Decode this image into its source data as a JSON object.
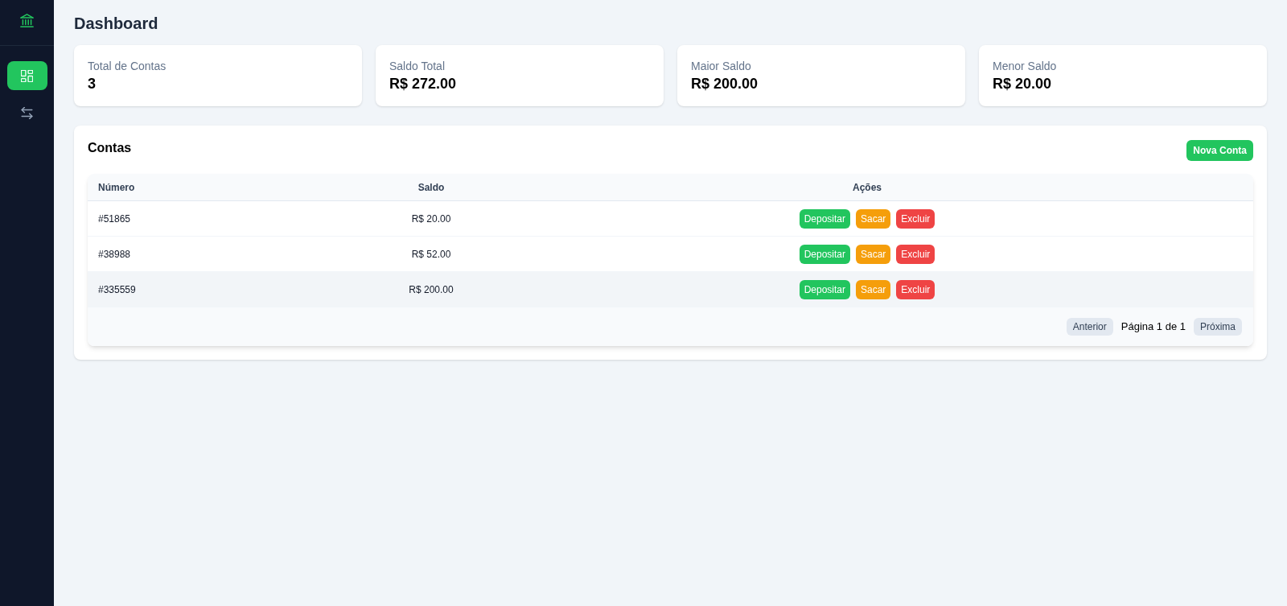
{
  "sidebar": {
    "nav_items": [
      {
        "selected": true
      },
      {
        "selected": false
      }
    ]
  },
  "page_title": "Dashboard",
  "stats": [
    {
      "label": "Total de Contas",
      "value": "3"
    },
    {
      "label": "Saldo Total",
      "value": "R$ 272.00"
    },
    {
      "label": "Maior Saldo",
      "value": "R$ 200.00"
    },
    {
      "label": "Menor Saldo",
      "value": "R$ 20.00"
    }
  ],
  "accounts_panel": {
    "title": "Contas",
    "new_button": "Nova Conta",
    "table": {
      "columns": [
        "Número",
        "Saldo",
        "Ações"
      ],
      "rows": [
        {
          "number": "#51865",
          "balance": "R$ 20.00",
          "highlighted": false,
          "actions": [
            {
              "kind": "deposit",
              "label": "Depositar"
            },
            {
              "kind": "withdraw",
              "label": "Sacar"
            },
            {
              "kind": "delete",
              "label": "Excluir"
            }
          ]
        },
        {
          "number": "#38988",
          "balance": "R$ 52.00",
          "highlighted": false,
          "actions": [
            {
              "kind": "deposit",
              "label": "Depositar"
            },
            {
              "kind": "withdraw",
              "label": "Sacar"
            },
            {
              "kind": "delete",
              "label": "Excluir"
            }
          ]
        },
        {
          "number": "#335559",
          "balance": "R$ 200.00",
          "highlighted": true,
          "actions": [
            {
              "kind": "deposit",
              "label": "Depositar"
            },
            {
              "kind": "withdraw",
              "label": "Sacar"
            },
            {
              "kind": "delete",
              "label": "Excluir"
            }
          ]
        }
      ]
    },
    "pagination": {
      "previous": "Anterior",
      "info": "Página 1 de 1",
      "next": "Próxima"
    }
  }
}
